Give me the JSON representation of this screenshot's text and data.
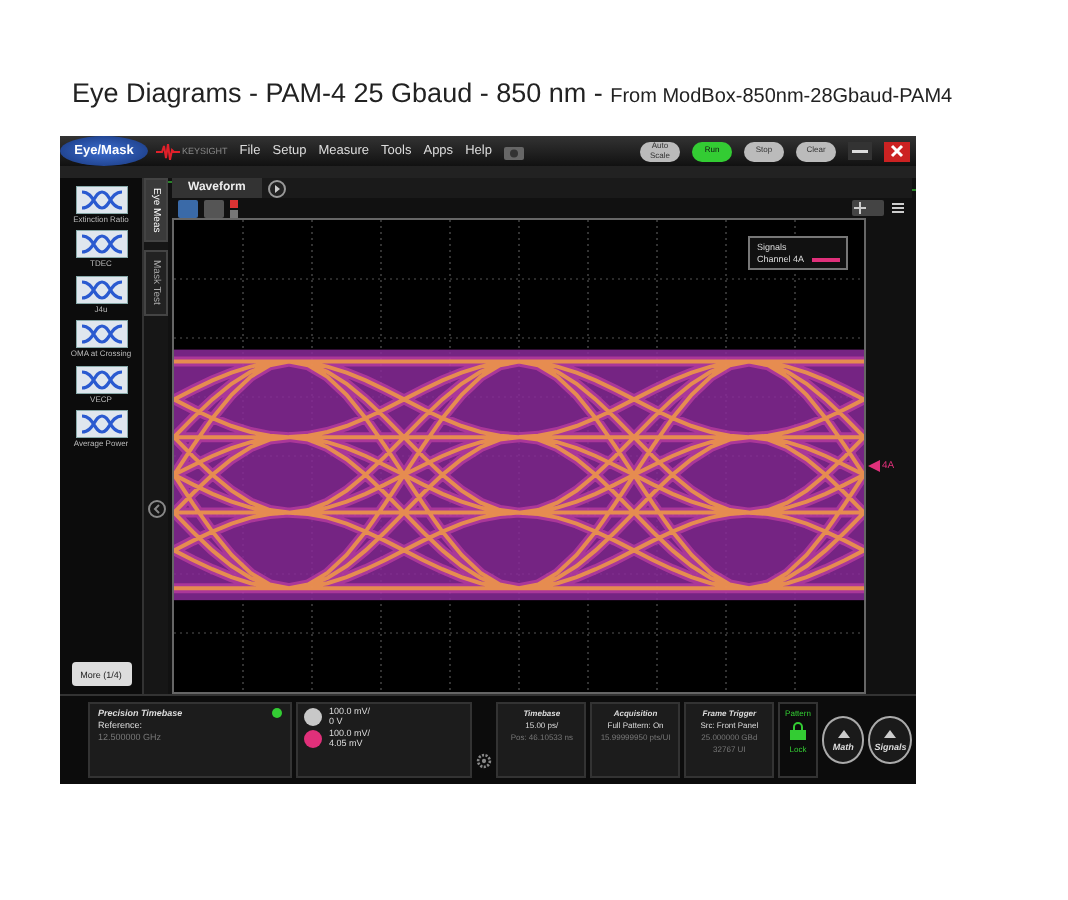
{
  "page_title": {
    "main": "Eye Diagrams - PAM-4 25 Gbaud - 850 nm - ",
    "sub": "From ModBox-850nm-28Gbaud-PAM4"
  },
  "menu_bar": {
    "mode_button": "Eye/Mask",
    "logo": "KEYSIGHT",
    "menus": [
      "File",
      "Setup",
      "Measure",
      "Tools",
      "Apps",
      "Help"
    ],
    "buttons": [
      {
        "label": "Auto Scale",
        "on": false
      },
      {
        "label": "Run",
        "on": true
      },
      {
        "label": "Stop",
        "on": false
      },
      {
        "label": "Clear",
        "on": false
      }
    ]
  },
  "side_tabs": [
    {
      "label": "Eye Meas",
      "selected": true
    },
    {
      "label": "Mask Test",
      "selected": false
    }
  ],
  "measurements": [
    "Extinction Ratio",
    "TDEC",
    "J4u",
    "OMA at Crossing",
    "VECP",
    "Average Power"
  ],
  "more_button": "More (1/4)",
  "waveform_tab": "Waveform",
  "legend": {
    "title": "Signals",
    "items": [
      {
        "name": "Channel 4A",
        "color": "#e0307a"
      }
    ]
  },
  "channel_marker": {
    "label": "4A",
    "color": "#e0307a"
  },
  "status_bar": {
    "timebase_panel": {
      "title": "Precision Timebase",
      "lines": [
        "Reference:",
        "12.500000 GHz"
      ],
      "locked": true
    },
    "channels": [
      {
        "scale": "100.0 mV/",
        "offset": "0 V",
        "color": "#c8c8c8"
      },
      {
        "scale": "100.0 mV/",
        "offset": "4.05 mV",
        "color": "#e0307a"
      }
    ],
    "panels": [
      {
        "title": "Timebase",
        "lines": [
          "15.00 ps/",
          "Pos: 46.10533 ns"
        ]
      },
      {
        "title": "Acquisition",
        "lines": [
          "Full Pattern: On",
          "15.99999950 pts/UI"
        ]
      },
      {
        "title": "Frame Trigger",
        "lines": [
          "Src: Front Panel",
          "25.000000 GBd",
          "32767 UI"
        ]
      }
    ],
    "pattern_lock": {
      "title": "Pattern",
      "label": "Lock",
      "locked": true
    },
    "round_buttons": [
      "Math",
      "Signals"
    ]
  }
}
